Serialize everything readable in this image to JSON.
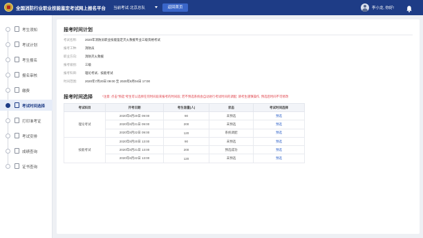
{
  "header": {
    "title": "全国消防行业职业技能鉴定考试网上报名平台",
    "current_exam_label": "当前考试:",
    "current_exam_value": "北京总队",
    "return_button": "返回首页",
    "greeting": "李小龙, 你好!",
    "colors": {
      "bar": "#1e3c86",
      "button": "#3a66c9"
    }
  },
  "sidebar": {
    "items": [
      {
        "label": "考生须知",
        "icon": "document-icon",
        "active": false
      },
      {
        "label": "考试计划",
        "icon": "calendar-icon",
        "active": false
      },
      {
        "label": "考生报名",
        "icon": "form-icon",
        "active": false
      },
      {
        "label": "报名审核",
        "icon": "review-icon",
        "active": false
      },
      {
        "label": "缴费",
        "icon": "payment-icon",
        "active": false
      },
      {
        "label": "考试时间选择",
        "icon": "clock-icon",
        "active": true
      },
      {
        "label": "打印准考证",
        "icon": "print-icon",
        "active": false
      },
      {
        "label": "考试安排",
        "icon": "schedule-icon",
        "active": false
      },
      {
        "label": "成绩查询",
        "icon": "score-icon",
        "active": false
      },
      {
        "label": "证书查询",
        "icon": "certificate-icon",
        "active": false
      }
    ]
  },
  "plan": {
    "title": "报考时间计划",
    "rows": [
      {
        "key": "考试名称:",
        "value": "2020年消防员职业技能鉴定灭火救援专业三级资格考试"
      },
      {
        "key": "报考工种:",
        "value": "消防员"
      },
      {
        "key": "职业方向:",
        "value": "消防灭火救援"
      },
      {
        "key": "报考级别:",
        "value": "三级"
      },
      {
        "key": "报考科目:",
        "value": "理论考试、技能考试"
      },
      {
        "key": "时间范围:",
        "value": "2020年7月20日 09:00 至 2020年8月04日 17:00"
      }
    ]
  },
  "selection": {
    "title": "报考时间选择",
    "notice": "*注意: 点击\"预选\"考生可以选择任何时间段来报考的时间段; 若不预选系统会自动进行考试时间的调配; 请考生谨慎操作, 预选后时间不可修改",
    "columns": [
      "考试科目",
      "开考日期",
      "考生容量(人)",
      "状态",
      "考试时间选择"
    ],
    "groups": [
      {
        "subject": "理论考试",
        "rows": [
          {
            "date": "2020年8月20日 09:00",
            "capacity": "90",
            "status": "未预选",
            "action": "预选"
          },
          {
            "date": "2020年8月21日 09:00",
            "capacity": "200",
            "status": "未预选",
            "action": "预选"
          },
          {
            "date": "2020年8月22日 09:00",
            "capacity": "120",
            "status": "系统调配",
            "action": "预选"
          }
        ]
      },
      {
        "subject": "技能考试",
        "rows": [
          {
            "date": "2020年8月20日 13:00",
            "capacity": "90",
            "status": "未预选",
            "action": "预选"
          },
          {
            "date": "2020年8月21日 13:00",
            "capacity": "200",
            "status": "预选成功",
            "action": "预选"
          },
          {
            "date": "2020年8月22日 13:00",
            "capacity": "120",
            "status": "未预选",
            "action": "预选"
          }
        ]
      }
    ],
    "colors": {
      "notice": "#e0434b",
      "link": "#2f62c9"
    }
  }
}
